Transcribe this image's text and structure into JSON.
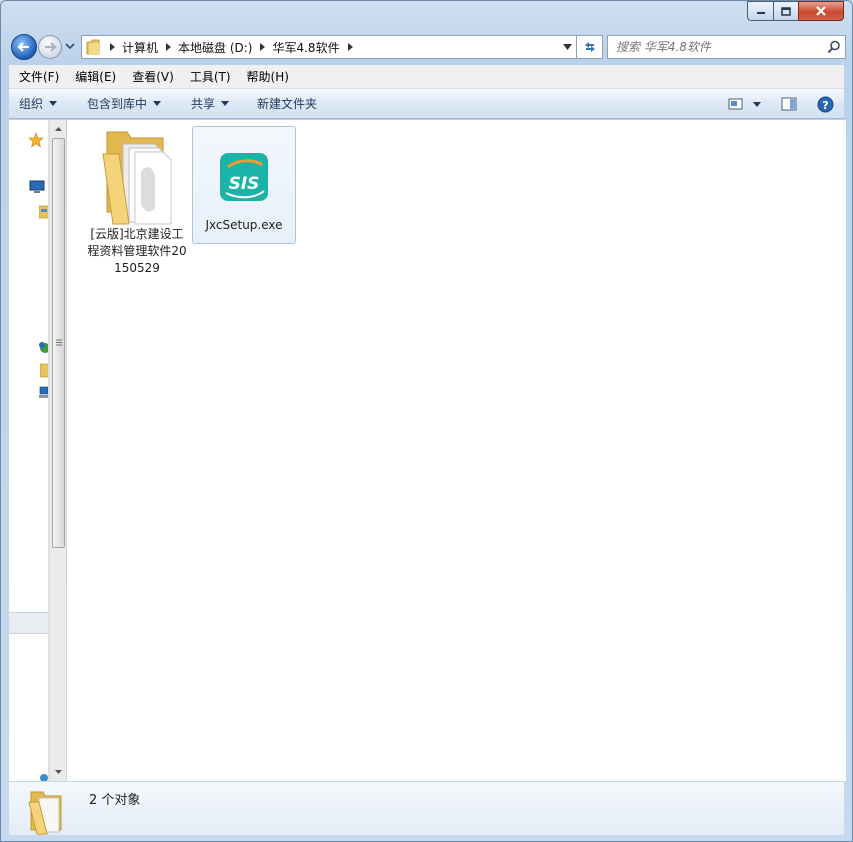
{
  "window": {
    "caption": {
      "minimize": "minimize",
      "maximize": "maximize",
      "close": "close"
    }
  },
  "address": {
    "crumbs": [
      "计算机",
      "本地磁盘 (D:)",
      "华军4.8软件"
    ]
  },
  "search": {
    "placeholder": "搜索 华军4.8软件"
  },
  "menu": {
    "items": [
      "文件(F)",
      "编辑(E)",
      "查看(V)",
      "工具(T)",
      "帮助(H)"
    ]
  },
  "toolbar": {
    "organize": "组织",
    "include_library": "包含到库中",
    "share": "共享",
    "new_folder": "新建文件夹"
  },
  "files": [
    {
      "name": "[云版]北京建设工程资料管理软件20150529",
      "type": "folder",
      "selected": false
    },
    {
      "name": "JxcSetup.exe",
      "type": "exe",
      "selected": true,
      "icon_text": "SIS"
    }
  ],
  "status": {
    "count_text": "2 个对象"
  },
  "colors": {
    "accent": "#1d5fb6",
    "sis_teal": "#1bb3a7",
    "sis_orange": "#f29a2e"
  }
}
